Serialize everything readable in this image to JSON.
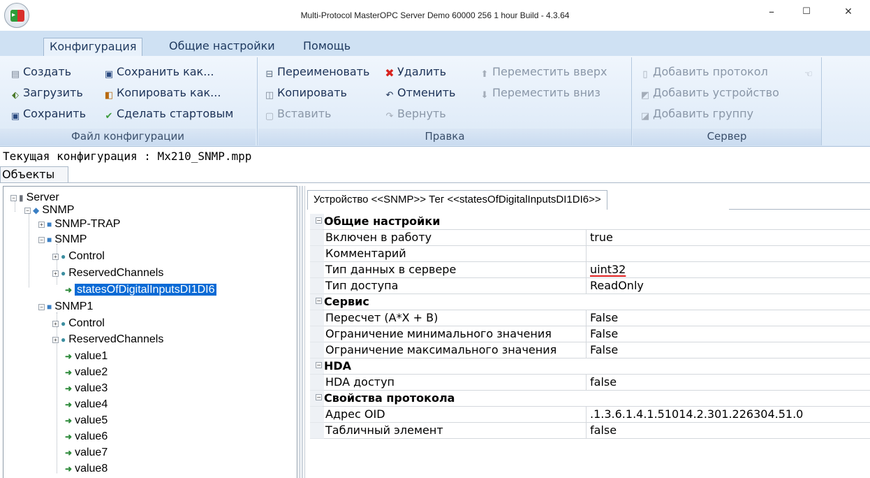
{
  "window": {
    "title": "Multi-Protocol MasterOPC Server Demo 60000 256 1 hour Build - 4.3.64",
    "minimize": "–",
    "maximize": "☐",
    "close": "✕"
  },
  "tabs": [
    "Конфигурация",
    "Общие настройки",
    "Помощь"
  ],
  "ribbon": {
    "file": {
      "label": "Файл конфигурации",
      "create": "Создать",
      "load": "Загрузить",
      "save": "Сохранить",
      "save_as": "Сохранить как...",
      "copy_as": "Копировать как...",
      "make_startup": "Сделать стартовым"
    },
    "edit": {
      "label": "Правка",
      "rename": "Переименовать",
      "copy": "Копировать",
      "paste": "Вставить",
      "delete": "Удалить",
      "undo": "Отменить",
      "redo": "Вернуть",
      "move_up": "Переместить вверх",
      "move_down": "Переместить вниз"
    },
    "server": {
      "label": "Сервер",
      "add_protocol": "Добавить протокол",
      "add_device": "Добавить устройство",
      "add_group": "Добавить группу"
    }
  },
  "current_config": "Текущая конфигурация : Mx210_SNMP.mpp",
  "objects_tab": "Объекты",
  "tree": {
    "server": "Server",
    "snmp_protocol": "SNMP",
    "snmp_trap": "SNMP-TRAP",
    "snmp_device": "SNMP",
    "control": "Control",
    "reserved": "ReservedChannels",
    "selected_tag": "statesOfDigitalInputsDI1DI6",
    "snmp1": "SNMP1",
    "control2": "Control",
    "reserved2": "ReservedChannels",
    "values": [
      "value1",
      "value2",
      "value3",
      "value4",
      "value5",
      "value6",
      "value7",
      "value8"
    ]
  },
  "device_tab": "Устройство <<SNMP>> Тег  <<statesOfDigitalInputsDI1DI6>>",
  "properties": {
    "general": {
      "header": "Общие настройки",
      "enabled_label": "Включен в работу",
      "enabled_value": "true",
      "comment_label": "Комментарий",
      "comment_value": "",
      "datatype_label": "Тип данных в сервере",
      "datatype_value": "uint32",
      "access_label": "Тип доступа",
      "access_value": "ReadOnly"
    },
    "service": {
      "header": "Сервис",
      "recalc_label": "Пересчет (A*X + B)",
      "recalc_value": "False",
      "minlim_label": "Ограничение минимального значения",
      "minlim_value": "False",
      "maxlim_label": "Ограничение максимального значения",
      "maxlim_value": "False"
    },
    "hda": {
      "header": "HDA",
      "access_label": "HDA доступ",
      "access_value": "false"
    },
    "protocol": {
      "header": "Свойства протокола",
      "oid_label": "Адрес OID",
      "oid_value": ".1.3.6.1.4.1.51014.2.301.226304.51.0",
      "table_label": "Табличный элемент",
      "table_value": "false"
    }
  },
  "colors": {
    "ribbon_bg": "#dce9f7",
    "tab_bar": "#cfe1f3",
    "selection": "#0a6ad5",
    "underline": "#e02020"
  }
}
